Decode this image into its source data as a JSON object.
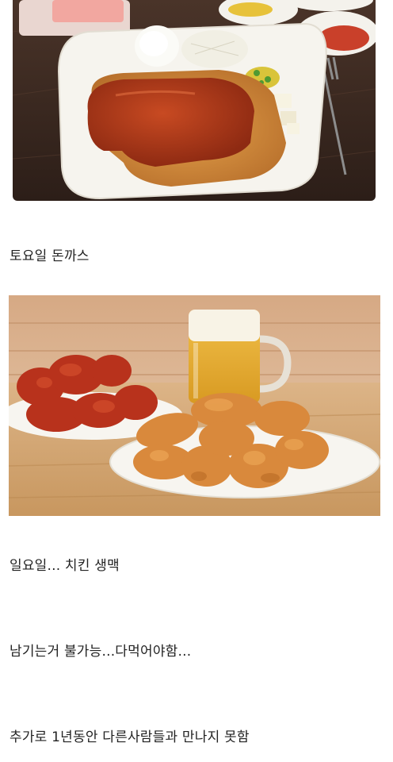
{
  "posts": [
    {
      "image": {
        "name": "tonkatsu-photo",
        "alt": "plate of tonkatsu with sauce, rice, cabbage salad"
      },
      "caption": "토요일 돈까스"
    },
    {
      "image": {
        "name": "fried-chicken-beer-photo",
        "alt": "plates of fried chicken and a mug of draft beer"
      },
      "caption": "일요일... 치킨 생맥"
    },
    {
      "caption": "남기는거 불가능...다먹어야함..."
    },
    {
      "caption": "추가로 1년동안 다른사람들과 만나지 못함"
    }
  ],
  "colors": {
    "table_dark": "#3b2a22",
    "plate": "#f7f5f0",
    "sauce": "#b2381a",
    "cutlet": "#d08a3a",
    "wood_light": "#d9b48a",
    "beer": "#e8b43c",
    "chicken_fried": "#d9893c",
    "chicken_sauced": "#b8321c"
  }
}
